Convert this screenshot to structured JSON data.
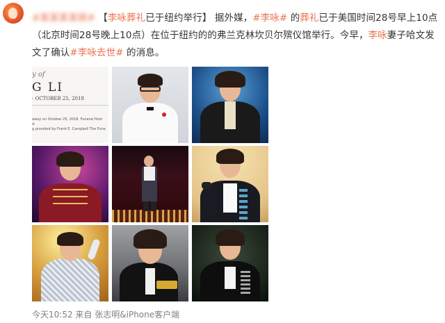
{
  "post": {
    "hashtag_blurred": "#某某某某报#",
    "bracket_open": "【",
    "title_link": "李咏葬礼",
    "title_rest": "已于纽约举行",
    "bracket_close": "】",
    "text_1": "据外媒，",
    "tag_1": "#李咏#",
    "text_2": " 的",
    "funeral_link": "葬礼",
    "text_3": "已于美国时间28号早上10点（北京时间28号晚上10点）在位于纽约的的弗兰克林坎贝尔殡仪馆举行。今早，",
    "name_link": "李咏",
    "text_4": "妻子哈文发文了确认",
    "tag_2": "#李咏去世#",
    "text_5": " 的消息。"
  },
  "document_photo": {
    "line1": "y of",
    "line2": "G LI",
    "line3": "- OCTOBER 25, 2018",
    "note1": "away on October 25, 2018. Funeral Hom",
    "note2": "d.",
    "note3": "g provided by Frank E. Campbell The Fune"
  },
  "photos": [
    {
      "name": "photo-document"
    },
    {
      "name": "photo-white-suit"
    },
    {
      "name": "photo-dark-suit-stage"
    },
    {
      "name": "photo-red-uniform"
    },
    {
      "name": "photo-stage-performance"
    },
    {
      "name": "photo-velvet-jacket-microphone"
    },
    {
      "name": "photo-silver-sequin-suit"
    },
    {
      "name": "photo-laughing-award"
    },
    {
      "name": "photo-tuxedo-dark"
    }
  ],
  "meta": {
    "time": "今天10:52",
    "from": "来自",
    "source": "张志明&iPhone客户端"
  },
  "colors": {
    "link": "#eb7350",
    "meta": "#808080"
  }
}
